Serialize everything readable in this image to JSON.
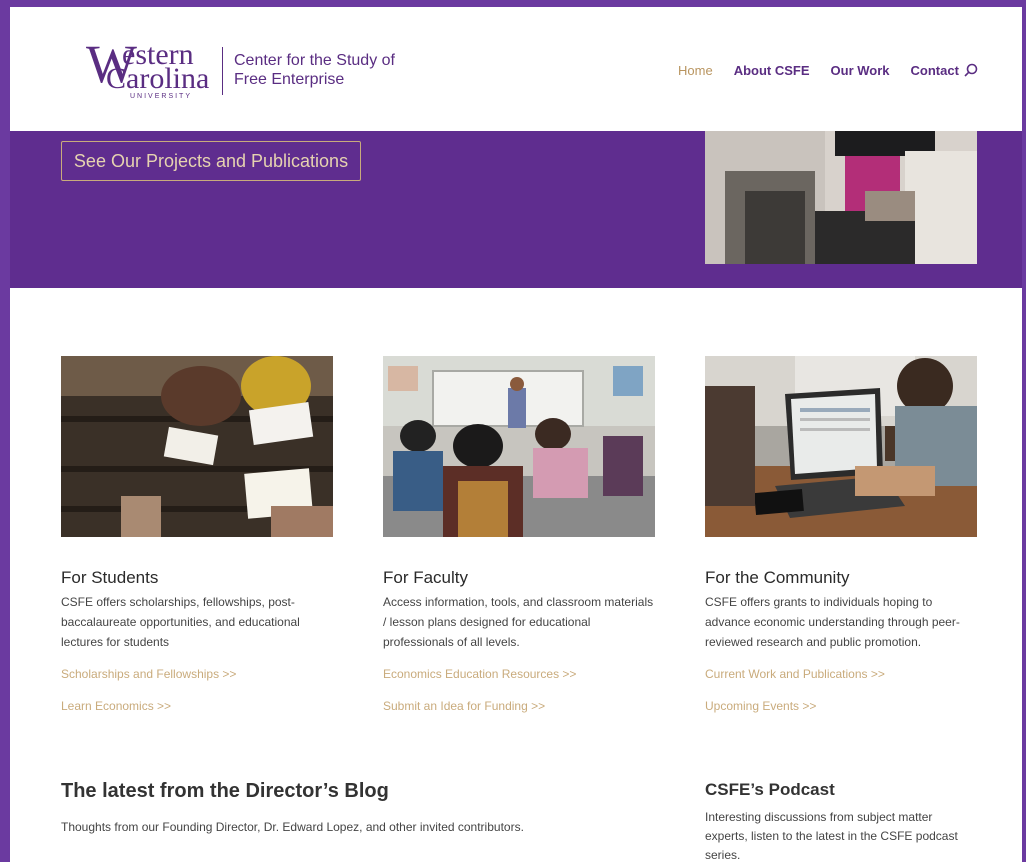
{
  "header": {
    "logo": {
      "w": "W",
      "estern": "estern",
      "carolina": "Carolina",
      "university": "UNIVERSITY"
    },
    "center_name": "Center for the Study of Free Enterprise",
    "nav": [
      {
        "label": "Home"
      },
      {
        "label": "About CSFE"
      },
      {
        "label": "Our Work"
      },
      {
        "label": "Contact"
      }
    ]
  },
  "hero": {
    "button_label": "See Our Projects and Publications"
  },
  "columns": [
    {
      "title": "For Students",
      "text": "CSFE offers scholarships, fellowships, post-baccalaureate opportunities, and educational lectures for students",
      "links": [
        "Scholarships and Fellowships >>",
        "Learn Economics >>"
      ]
    },
    {
      "title": "For Faculty",
      "text": "Access information, tools, and classroom materials / lesson plans designed for educational professionals of all levels.",
      "links": [
        "Economics Education Resources >>",
        "Submit an Idea for Funding >>"
      ]
    },
    {
      "title": "For the Community",
      "text": "CSFE offers grants to individuals hoping to advance economic understanding through peer-reviewed research and public promotion.",
      "links": [
        "Current Work and Publications >>",
        "Upcoming Events >>"
      ]
    }
  ],
  "blog": {
    "title": "The latest from the Director’s Blog",
    "text": "Thoughts from our Founding Director, Dr. Edward Lopez, and other invited contributors."
  },
  "podcast": {
    "title": "CSFE’s Podcast",
    "text": "Interesting discussions from subject matter experts, listen to the latest in the CSFE podcast series."
  },
  "colors": {
    "purple": "#5f2d8f",
    "gold": "#c9ab7c",
    "brand": "#5a2d82"
  }
}
